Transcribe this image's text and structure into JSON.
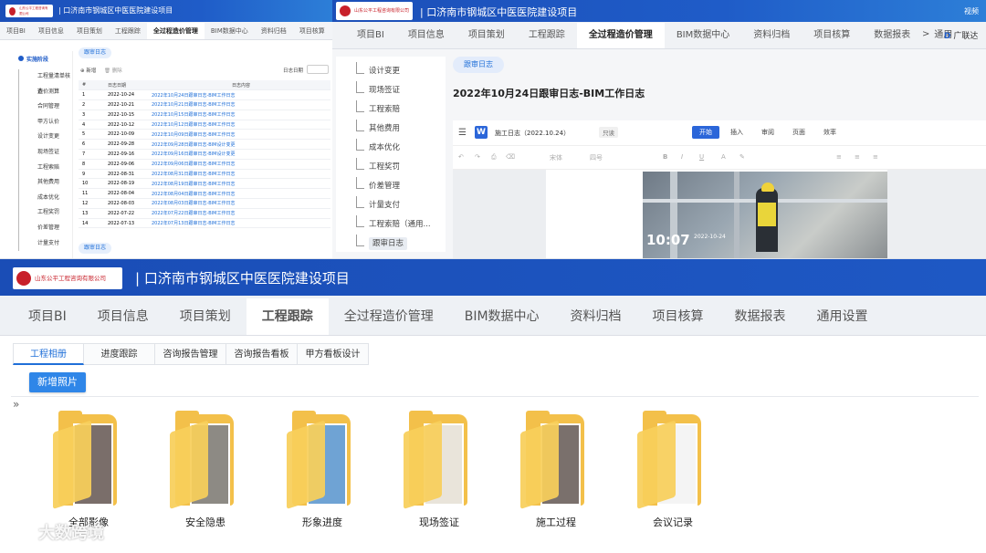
{
  "colors": {
    "header_blue": "#1f5cc8",
    "link_blue": "#1f6fd8",
    "folder_yellow": "#f3c04a",
    "brand_red": "#c8202a"
  },
  "company_logo_text": "山东公平工程咨询有限公司",
  "panel1": {
    "project_title": "| 口济南市钢城区中医医院建设项目",
    "tabs": [
      "项目BI",
      "项目信息",
      "项目策划",
      "工程跟踪",
      "全过程造价管理",
      "BIM数据中心",
      "资料归档",
      "项目核算",
      "数据报"
    ],
    "active_tab": "全过程造价管理",
    "sidebar_group": "实施阶段",
    "sidebar_items": [
      "工程量清单核查",
      "造价测算",
      "合同管理",
      "甲方认价",
      "设计变更",
      "现场签证",
      "工程索赔",
      "其他费用",
      "成本优化",
      "工程奖罚",
      "价差管理",
      "计量支付"
    ],
    "page_chip": "跟审日志",
    "toolbar": {
      "add": "新增",
      "delete": "删除",
      "date_filter": "日志日期"
    },
    "table_headers": [
      "#",
      "日志日期",
      "日志内容"
    ],
    "rows": [
      {
        "no": "1",
        "date": "2022-10-24",
        "content": "2022年10月24日跟审日志-BIM工作日志"
      },
      {
        "no": "2",
        "date": "2022-10-21",
        "content": "2022年10月21日跟审日志-BIM工作日志"
      },
      {
        "no": "3",
        "date": "2022-10-15",
        "content": "2022年10月15日跟审日志-BIM工作日志"
      },
      {
        "no": "4",
        "date": "2022-10-12",
        "content": "2022年10月12日跟审日志-BIM工作日志"
      },
      {
        "no": "5",
        "date": "2022-10-09",
        "content": "2022年10月09日跟审日志-BIM工作日志"
      },
      {
        "no": "6",
        "date": "2022-09-28",
        "content": "2022年09月28日跟审日志-BIM设计变更"
      },
      {
        "no": "7",
        "date": "2022-09-16",
        "content": "2022年09月16日跟审日志-BIM设计变更"
      },
      {
        "no": "8",
        "date": "2022-09-06",
        "content": "2022年09月06日跟审日志-BIM工作日志"
      },
      {
        "no": "9",
        "date": "2022-08-31",
        "content": "2022年08月31日跟审日志-BIM工作日志"
      },
      {
        "no": "10",
        "date": "2022-08-19",
        "content": "2022年08月19日跟审日志-BIM工作日志"
      },
      {
        "no": "11",
        "date": "2022-08-04",
        "content": "2022年08月04日跟审日志-BIM工作日志"
      },
      {
        "no": "12",
        "date": "2022-08-03",
        "content": "2022年08月03日跟审日志-BIM工作日志"
      },
      {
        "no": "13",
        "date": "2022-07-22",
        "content": "2022年07月22日跟审日志-BIM工作日志"
      },
      {
        "no": "14",
        "date": "2022-07-13",
        "content": "2022年07月13日跟审日志-BIM工作日志"
      }
    ],
    "footer_chip": "跟审日志"
  },
  "panel2": {
    "project_title": "| 口济南市钢城区中医医院建设项目",
    "header_right": "视频",
    "tabs": [
      "项目BI",
      "项目信息",
      "项目策划",
      "工程跟踪",
      "全过程造价管理",
      "BIM数据中心",
      "资料归档",
      "项目核算",
      "数据报表",
      "通用"
    ],
    "active_tab": "全过程造价管理",
    "tab_more": ">",
    "tab_extra": "广联达",
    "sidebar_items": [
      "设计变更",
      "现场签证",
      "工程索赔",
      "其他费用",
      "成本优化",
      "工程奖罚",
      "价差管理",
      "计量支付",
      "工程索赔（通用...",
      "跟审日志"
    ],
    "active_side": "跟审日志",
    "chip": "跟审日志",
    "doc_title": "2022年10月24日跟审日志-BIM工作日志",
    "doc_name": "施工日志（2022.10.24）",
    "doc_status": "只读",
    "doc_menus": [
      "开始",
      "插入",
      "审阅",
      "页面",
      "效率"
    ],
    "font_name": "宋体",
    "font_size": "四号",
    "photo_time": "10:07",
    "photo_date": "2022-10-24"
  },
  "panel3": {
    "project_title": "| 口济南市钢城区中医医院建设项目",
    "tabs": [
      "项目BI",
      "项目信息",
      "项目策划",
      "工程跟踪",
      "全过程造价管理",
      "BIM数据中心",
      "资料归档",
      "项目核算",
      "数据报表",
      "通用设置"
    ],
    "active_tab": "工程跟踪",
    "subtabs": [
      "工程相册",
      "进度跟踪",
      "咨询报告管理",
      "咨询报告看板",
      "甲方看板设计"
    ],
    "new_photo_button": "新增照片",
    "collapse_icon": "»",
    "folders": [
      {
        "label": "全部影像",
        "photo_color": "#7a6e6a"
      },
      {
        "label": "安全隐患",
        "photo_color": "#8d8a84"
      },
      {
        "label": "形象进度",
        "photo_color": "#6fa3d4"
      },
      {
        "label": "现场签证",
        "photo_color": "#e9e4da"
      },
      {
        "label": "施工过程",
        "photo_color": "#7a706c"
      },
      {
        "label": "会议记录",
        "photo_color": "#f4f4f4"
      }
    ]
  },
  "watermark": "大数跨境"
}
